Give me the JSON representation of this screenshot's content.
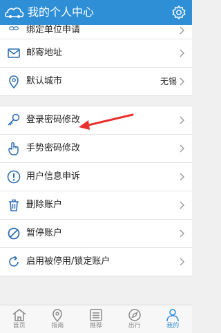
{
  "header": {
    "title": "我的个人中心"
  },
  "menu": {
    "items": [
      {
        "label": "绑定单位申请",
        "icon": "link-icon"
      },
      {
        "label": "邮寄地址",
        "icon": "mail-icon"
      },
      {
        "label": "默认城市",
        "value": "无锡",
        "icon": "location-pin-icon"
      },
      {
        "label": "登录密码修改",
        "icon": "key-icon"
      },
      {
        "label": "手势密码修改",
        "icon": "hand-pointer-icon"
      },
      {
        "label": "用户信息申诉",
        "icon": "exclamation-icon"
      },
      {
        "label": "删除账户",
        "icon": "trash-icon"
      },
      {
        "label": "暂停账户",
        "icon": "ban-icon"
      },
      {
        "label": "启用被停用/锁定账户",
        "icon": "refresh-icon"
      }
    ]
  },
  "tabbar": {
    "tabs": [
      {
        "label": "首页",
        "icon": "home-icon"
      },
      {
        "label": "指南",
        "icon": "map-pin-icon"
      },
      {
        "label": "推荐",
        "icon": "list-icon"
      },
      {
        "label": "出行",
        "icon": "compass-icon"
      },
      {
        "label": "我的",
        "icon": "user-icon"
      }
    ],
    "active": "我的"
  },
  "colors": {
    "accent": "#2f8fd6",
    "annotation_arrow": "#e8312f"
  }
}
